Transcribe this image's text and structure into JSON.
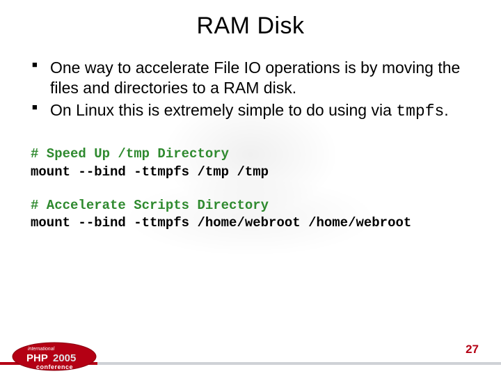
{
  "title": "RAM Disk",
  "bullets": [
    {
      "text": "One way to accelerate File IO operations is by moving the files and directories to a RAM disk."
    },
    {
      "prefix": "On Linux this is extremely simple to do using via ",
      "code": "tmpfs",
      "suffix": "."
    }
  ],
  "code": {
    "block1": {
      "comment": "# Speed Up /tmp Directory",
      "cmd": "mount --bind -ttmpfs /tmp /tmp"
    },
    "block2": {
      "comment": "# Accelerate Scripts Directory",
      "cmd": "mount --bind -ttmpfs /home/webroot /home/webroot"
    }
  },
  "footer": {
    "page_number": "27",
    "logo": {
      "line1": "international",
      "brand": "PHP",
      "year": "2005",
      "line2": "conference"
    }
  },
  "colors": {
    "accent": "#b40014",
    "comment": "#2f8a2f"
  }
}
